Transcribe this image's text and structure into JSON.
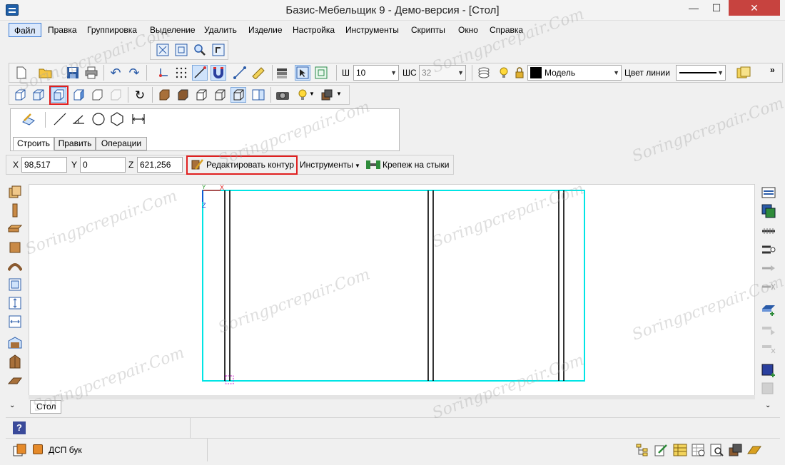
{
  "window": {
    "title": "Базис-Мебельщик 9 - Демо-версия - [Стол]",
    "min_glyph": "—",
    "max_glyph": "☐",
    "close_glyph": "✕"
  },
  "menu": [
    {
      "label": "Файл",
      "active": true
    },
    {
      "label": "Правка"
    },
    {
      "label": "Группировка"
    },
    {
      "label": "Выделение"
    },
    {
      "label": "Удалить"
    },
    {
      "label": "Изделие"
    },
    {
      "label": "Настройка"
    },
    {
      "label": "Инструменты"
    },
    {
      "label": "Скрипты"
    },
    {
      "label": "Окно"
    },
    {
      "label": "Справка"
    }
  ],
  "toolbar": {
    "width_label": "Ш",
    "width_value": "10",
    "step_label": "ШС",
    "step_value": "32",
    "layer_value": "Модель",
    "layer_color": "#000000",
    "line_color_label": "Цвет линии",
    "overflow_glyph": "»"
  },
  "palette": {
    "tabs": [
      "Строить",
      "Править",
      "Операции"
    ],
    "active_tab": "Строить"
  },
  "coords": {
    "x_label": "X",
    "x_value": "98,517",
    "y_label": "Y",
    "y_value": "0",
    "z_label": "Z",
    "z_value": "621,256",
    "edit_contour_label": "Редактировать контур",
    "tools_label": "Инструменты",
    "fasteners_label": "Крепеж на стыки"
  },
  "drawing": {
    "axis_x": "X",
    "axis_y": "Y",
    "axis_z": "Z",
    "outline_color": "#00e5e5"
  },
  "doc_tabs": [
    "Стол"
  ],
  "status": {
    "material_label": "ДСП бук",
    "help_glyph": "?"
  },
  "watermark_text": "Soringpcrepair.Com"
}
